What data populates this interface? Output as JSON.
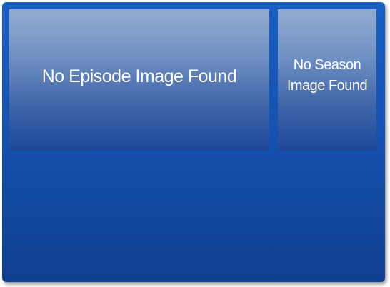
{
  "episode_image": {
    "placeholder_text": "No Episode Image Found"
  },
  "season_image": {
    "placeholder_text": "No Season Image Found"
  },
  "colors": {
    "frame_top": "#1a5fc4",
    "frame_bottom": "#0f3f8f",
    "placeholder_top": "#93acd0",
    "placeholder_bottom": "#1e479a",
    "text": "#ffffff"
  }
}
